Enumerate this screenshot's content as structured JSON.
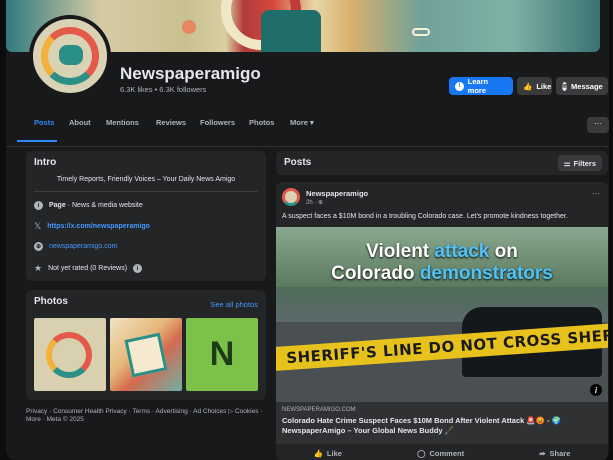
{
  "page": {
    "name": "Newspaperamigo",
    "stats": "6.3K likes • 6.3K followers"
  },
  "actions": {
    "learn_more": "Learn more",
    "like": "Like",
    "message": "Message"
  },
  "tabs": [
    "Posts",
    "About",
    "Mentions",
    "Reviews",
    "Followers",
    "Photos",
    "More ▾"
  ],
  "intro": {
    "title": "Intro",
    "bio": "Timely Reports, Friendly Voices – Your Daily News Amigo",
    "page_label": "Page",
    "page_category": " · News & media website",
    "x_link": "https://x.com/newspaperamigo",
    "website": "newspaperamigo.com",
    "rating": "Not yet rated (0 Reviews)"
  },
  "photos": {
    "title": "Photos",
    "see_all": "See all photos",
    "thumb3_letter": "N"
  },
  "footer": "Privacy · Consumer Health Privacy · Terms · Advertising · Ad Choices ▷ Cookies · More · Meta © 2025",
  "posts": {
    "title": "Posts",
    "filters": "Filters"
  },
  "post": {
    "author": "Newspaperamigo",
    "time": "2h · ",
    "text": "A suspect faces a $10M bond in a troubling Colorado case. Let's promote kindness together.",
    "image_headline_line1_a": "Violent ",
    "image_headline_line1_b": "attack",
    "image_headline_line1_c": " on",
    "image_headline_line2_a": "Colorado ",
    "image_headline_line2_b": "demonstrators",
    "tape_text": "SHERIFF'S LINE DO NOT CROSS     SHERIFF'S LI",
    "link_domain": "NEWSPAPERAMIGO.COM",
    "link_title": "Colorado Hate Crime Suspect Faces $10M Bond After Violent Attack 🚨😡 - 🌍 NewspaperAmigo – Your Global News Buddy 🖋️",
    "like": "Like",
    "comment": "Comment",
    "share": "Share"
  }
}
